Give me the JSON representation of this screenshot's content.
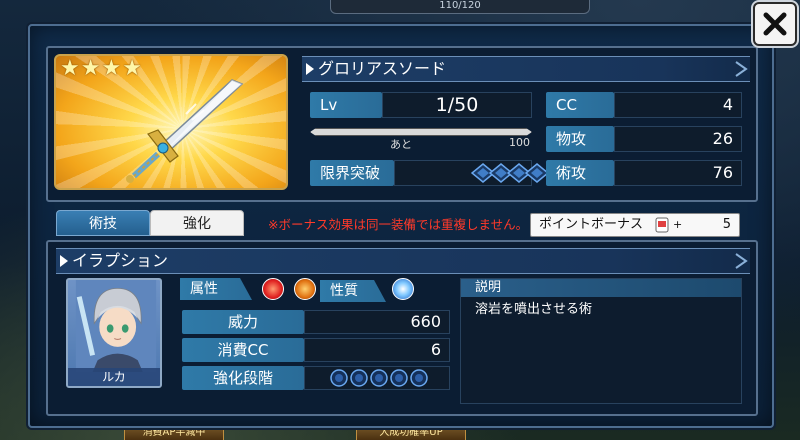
{
  "weapon": {
    "name": "グロリアスソード",
    "rarity_stars": 4,
    "level_label": "Lv",
    "level_value": "1/50",
    "exp_prefix": "あと",
    "exp_remaining": "100",
    "exp_progress": 0,
    "limit_break_label": "限界突破",
    "limit_break_slots": 4,
    "stats": [
      {
        "label": "CC",
        "value": "4"
      },
      {
        "label": "物攻",
        "value": "26"
      },
      {
        "label": "術攻",
        "value": "76"
      }
    ]
  },
  "tabs": [
    {
      "label": "術技",
      "active": true
    },
    {
      "label": "強化",
      "active": false
    }
  ],
  "notice": "※ボーナス効果は同一装備では重複しません。",
  "bonus": {
    "label": "ポイントボーナス",
    "plus": "+",
    "value": "5"
  },
  "skill": {
    "name": "イラプション",
    "character_name": "ルカ",
    "attribute_label": "属性",
    "nature_label": "性質",
    "power_label": "威力",
    "power_value": "660",
    "cost_label": "消費CC",
    "cost_value": "6",
    "enhance_label": "強化段階",
    "enhance_slots": 5,
    "description_head": "説明",
    "description": "溶岩を噴出させる術",
    "attribute_icons": [
      "fire-element-icon",
      "earth-element-icon"
    ],
    "nature_icon": "nature-sparkle-icon"
  },
  "background": {
    "top_status": "110/120",
    "bottom_left": "消費AP半減中",
    "bottom_mid": "大成功確率UP"
  },
  "colors": {
    "panel_bg": "#0b1d33",
    "label_blue": "#2f7aa8",
    "notice_red": "#ff3a2a",
    "gem_blue": "#4a8fe0",
    "card_gold": "#f3a51a"
  }
}
